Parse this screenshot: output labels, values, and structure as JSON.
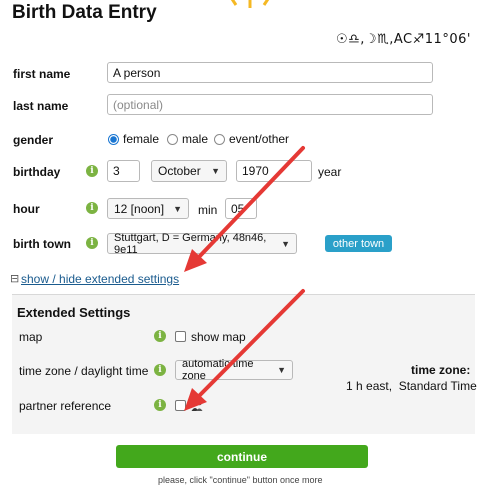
{
  "header": {
    "title": "Birth Data Entry",
    "astro_summary": "☉♎,☽♏,AC♐11°06'"
  },
  "form": {
    "first_name": {
      "label": "first name",
      "value": "A person"
    },
    "last_name": {
      "label": "last name",
      "placeholder": "(optional)"
    },
    "gender": {
      "label": "gender",
      "options": [
        "female",
        "male",
        "event/other"
      ],
      "selected": "female"
    },
    "birthday": {
      "label": "birthday",
      "day": "3",
      "month": "October",
      "year": "1970",
      "year_label": "year"
    },
    "hour": {
      "label": "hour",
      "hour_value": "12 [noon]",
      "min_label": "min",
      "minute": "05"
    },
    "birth_town": {
      "label": "birth town",
      "value": "Stuttgart, D = Germany, 48n46, 9e11",
      "other_button": "other town"
    }
  },
  "toggle": {
    "icon": "⊟",
    "label": "show / hide extended settings"
  },
  "extended": {
    "title": "Extended Settings",
    "map": {
      "label": "map",
      "checkbox_label": "show map",
      "checked": false
    },
    "timezone": {
      "label": "time zone / daylight time",
      "value": "automatic time zone",
      "info_title": "time zone:",
      "info_value": "1 h east,  Standard Time"
    },
    "partner": {
      "label": "partner reference",
      "checked": false
    }
  },
  "footer": {
    "continue_label": "continue",
    "hint": "please, click \"continue\" button once more"
  },
  "colors": {
    "continue_green": "#43a81c",
    "info_green": "#7cb342",
    "other_town_blue": "#2aa0c9",
    "annotation_arrow_red": "#e53935",
    "sun_yellow": "#f5b823"
  },
  "icons": {
    "info": "info-icon",
    "dropdown": "chevron-down-icon",
    "sun": "sun-icon",
    "partner": "partner-icon"
  }
}
